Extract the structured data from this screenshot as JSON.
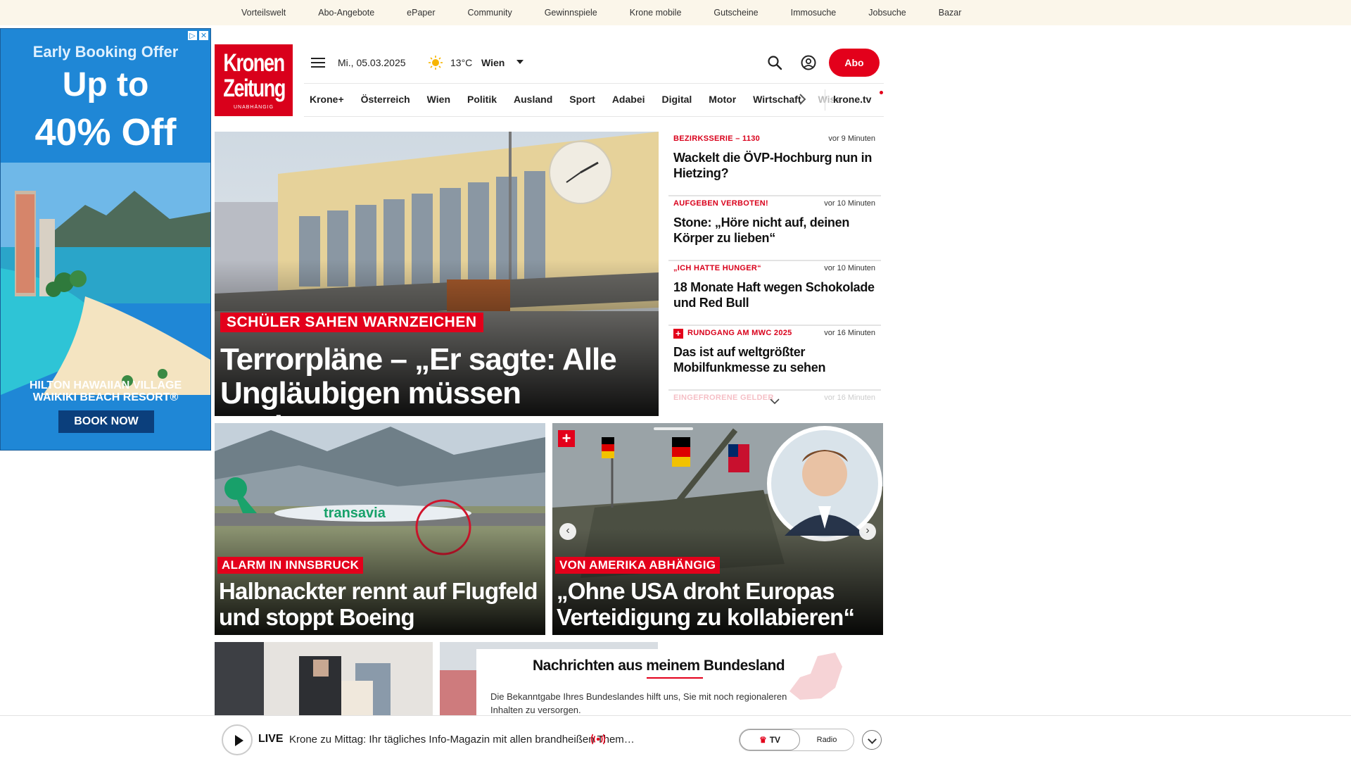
{
  "topbar": {
    "links": [
      "Vorteilswelt",
      "Abo-Angebote",
      "ePaper",
      "Community",
      "Gewinnspiele",
      "Krone mobile",
      "Gutscheine",
      "Immosuche",
      "Jobsuche",
      "Bazar"
    ]
  },
  "ad": {
    "headline": "Early Booking Offer",
    "offer_line1": "Up to",
    "offer_line2": "40% Off",
    "hotel_line1": "HILTON HAWAIIAN VILLAGE",
    "hotel_line2": "WAIKIKI BEACH RESORT®",
    "cta": "BOOK NOW"
  },
  "header": {
    "logo_line1": "Kronen",
    "logo_line2": "Zeitung",
    "logo_tagline": "UNABHÄNGIG",
    "date": "Mi., 05.03.2025",
    "temperature": "13°C",
    "city": "Wien",
    "abo_label": "Abo",
    "accent_color": "#e3001b"
  },
  "nav": {
    "items": [
      "Krone+",
      "Österreich",
      "Wien",
      "Politik",
      "Ausland",
      "Sport",
      "Adabei",
      "Digital",
      "Motor",
      "Wirtschaft",
      "Wiss"
    ],
    "tv": "krone.tv"
  },
  "hero": {
    "kicker": "SCHÜLER SAHEN WARNZEICHEN",
    "title": "Terrorpläne – „Er sagte: Alle Ungläubigen müssen sterben“"
  },
  "ticker": {
    "items": [
      {
        "kicker": "BEZIRKSSERIE – 1130",
        "time": "vor 9 Minuten",
        "title": "Wackelt die ÖVP-Hochburg nun in Hietzing?"
      },
      {
        "kicker": "AUFGEBEN VERBOTEN!",
        "time": "vor 10 Minuten",
        "title": "Stone: „Höre nicht auf, deinen Körper zu lieben“"
      },
      {
        "kicker": "„ICH HATTE HUNGER“",
        "time": "vor 10 Minuten",
        "title": "18 Monate Haft wegen Schokolade und Red Bull"
      },
      {
        "kicker": "RUNDGANG AM MWC 2025",
        "time": "vor 16 Minuten",
        "title": "Das ist auf weltgrößter Mobilfunkmesse zu sehen",
        "plus": "+"
      },
      {
        "kicker": "EINGEFRORENE GELDER",
        "time": "vor 16 Minuten",
        "title": ""
      }
    ]
  },
  "teasers": [
    {
      "kicker": "ALARM IN INNSBRUCK",
      "title": "Halbnackter rennt auf Flugfeld und stoppt Boeing",
      "plane_text": "transavia"
    },
    {
      "kicker": "VON AMERIKA ABHÄNGIG",
      "title": "„Ohne USA droht Europas Verteidigung zu kollabieren“",
      "badge": "+"
    }
  ],
  "bundesland": {
    "title": "Nachrichten aus meinem Bundesland",
    "description": "Die Bekanntgabe Ihres Bundeslandes hilft uns, Sie mit noch regionaleren Inhalten zu versorgen."
  },
  "livebar": {
    "live": "LIVE",
    "text": "Krone zu Mittag: Ihr tägliches Info-Magazin mit allen brandheißen Them…",
    "tv": "TV",
    "radio": "Radio"
  }
}
